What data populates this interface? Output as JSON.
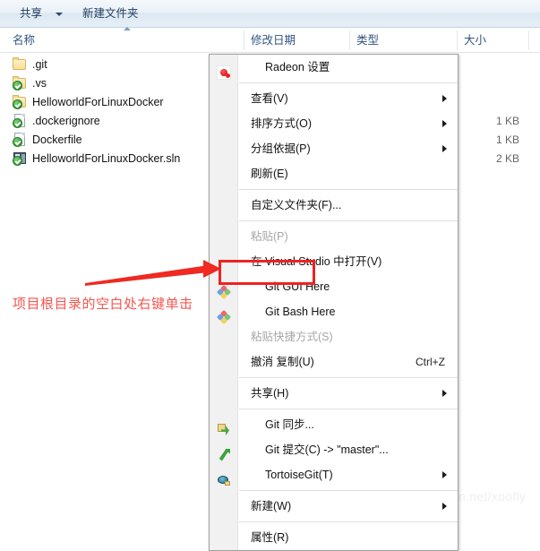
{
  "toolbar": {
    "share_label": "共享",
    "share_caret_icon": "chevron-down-icon",
    "new_folder_label": "新建文件夹"
  },
  "columns": {
    "name": "名称",
    "date_modified": "修改日期",
    "type": "类型",
    "size": "大小"
  },
  "files": [
    {
      "name": ".git",
      "icon": "folder-icon",
      "overlay": "none",
      "size": ""
    },
    {
      "name": ".vs",
      "icon": "folder-icon",
      "overlay": "green-check-icon",
      "size": ""
    },
    {
      "name": "HelloworldForLinuxDocker",
      "icon": "folder-icon",
      "overlay": "green-check-icon",
      "size": ""
    },
    {
      "name": ".dockerignore",
      "icon": "document-icon",
      "overlay": "green-check-icon",
      "size": "1 KB"
    },
    {
      "name": "Dockerfile",
      "icon": "document-icon",
      "overlay": "green-check-icon",
      "size": "1 KB"
    },
    {
      "name": "HelloworldForLinuxDocker.sln",
      "icon": "solution-icon",
      "overlay": "green-check-icon",
      "size": "2 KB"
    }
  ],
  "context_menu": {
    "items": [
      {
        "label": "Radeon 设置",
        "icon": "radeon-icon",
        "submenu": false,
        "disabled": false,
        "accel": ""
      },
      {
        "label": "查看(V)",
        "icon": "none",
        "submenu": true,
        "disabled": false,
        "accel": ""
      },
      {
        "label": "排序方式(O)",
        "icon": "none",
        "submenu": true,
        "disabled": false,
        "accel": ""
      },
      {
        "label": "分组依据(P)",
        "icon": "none",
        "submenu": true,
        "disabled": false,
        "accel": ""
      },
      {
        "label": "刷新(E)",
        "icon": "none",
        "submenu": false,
        "disabled": false,
        "accel": ""
      },
      {
        "label": "自定义文件夹(F)...",
        "icon": "none",
        "submenu": false,
        "disabled": false,
        "accel": ""
      },
      {
        "label": "粘贴(P)",
        "icon": "none",
        "submenu": false,
        "disabled": true,
        "accel": ""
      },
      {
        "label": "在 Visual Studio 中打开(V)",
        "icon": "none",
        "submenu": false,
        "disabled": false,
        "accel": ""
      },
      {
        "label": "Git GUI Here",
        "icon": "git-icon",
        "submenu": false,
        "disabled": false,
        "accel": ""
      },
      {
        "label": "Git Bash Here",
        "icon": "git-icon",
        "submenu": false,
        "disabled": false,
        "accel": ""
      },
      {
        "label": "粘贴快捷方式(S)",
        "icon": "none",
        "submenu": false,
        "disabled": true,
        "accel": ""
      },
      {
        "label": "撤消 复制(U)",
        "icon": "none",
        "submenu": false,
        "disabled": false,
        "accel": "Ctrl+Z"
      },
      {
        "label": "共享(H)",
        "icon": "none",
        "submenu": true,
        "disabled": false,
        "accel": ""
      },
      {
        "label": "Git 同步...",
        "icon": "git-sync-icon",
        "submenu": false,
        "disabled": false,
        "accel": ""
      },
      {
        "label": "Git 提交(C) -> \"master\"...",
        "icon": "git-commit-icon",
        "submenu": false,
        "disabled": false,
        "accel": ""
      },
      {
        "label": "TortoiseGit(T)",
        "icon": "tortoise-icon",
        "submenu": true,
        "disabled": false,
        "accel": ""
      },
      {
        "label": "新建(W)",
        "icon": "none",
        "submenu": true,
        "disabled": false,
        "accel": ""
      },
      {
        "label": "属性(R)",
        "icon": "none",
        "submenu": false,
        "disabled": false,
        "accel": ""
      }
    ]
  },
  "annotation": {
    "text": "项目根目录的空白处右键单击",
    "color": "#f4564f",
    "arrow_icon": "arrow-right-icon",
    "highlight_target": "Git Bash Here"
  },
  "watermark": {
    "text": "https://blog.csdn.net/xoofly"
  }
}
